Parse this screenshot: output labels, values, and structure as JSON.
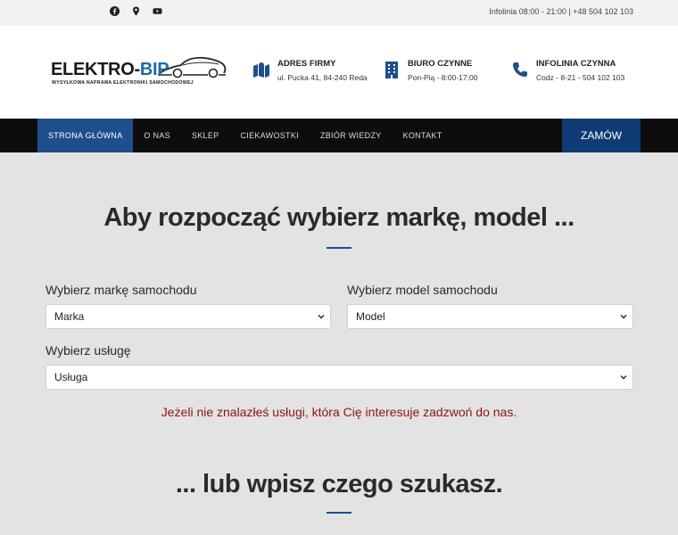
{
  "topbar": {
    "social": [
      "facebook-icon",
      "map-pin-icon",
      "youtube-icon"
    ],
    "info": "Infolinia 08:00 - 21:00 | +48 504 102 103"
  },
  "logo": {
    "brand_main": "ELEKTRO-",
    "brand_accent": "BIP",
    "tagline": "WYSYŁKOWA NAPRAWA ELEKTRONIKI SAMOCHODOWEJ"
  },
  "contacts": [
    {
      "icon": "map-icon",
      "title": "ADRES FIRMY",
      "detail": "ul. Pucka 41, 84-240 Reda"
    },
    {
      "icon": "building-icon",
      "title": "BIURO CZYNNE",
      "detail": "Pon-Pią - 8:00-17:00"
    },
    {
      "icon": "phone-icon",
      "title": "INFOLINIA CZYNNA",
      "detail": "Codz - 8-21 - 504 102 103"
    }
  ],
  "nav": {
    "items": [
      "STRONA GŁÓWNA",
      "O NAS",
      "SKLEP",
      "CIEKAWOSTKI",
      "ZBIÓR WIEDZY",
      "KONTAKT"
    ],
    "order": "ZAMÓW"
  },
  "main": {
    "title": "Aby rozpocząć wybierz markę, model ...",
    "brand_label": "Wybierz markę samochodu",
    "brand_value": "Marka",
    "model_label": "Wybierz model samochodu",
    "model_value": "Model",
    "service_label": "Wybierz usługę",
    "service_value": "Usługa",
    "note": "Jeżeli nie znalazłeś usługi, która Cię interesuje zadzwoń do nas.",
    "title2": "... lub wpisz czego szukasz."
  },
  "colors": {
    "accent": "#1e4f8c",
    "note": "#8b1414",
    "nav_bg": "#0d0d0d"
  }
}
